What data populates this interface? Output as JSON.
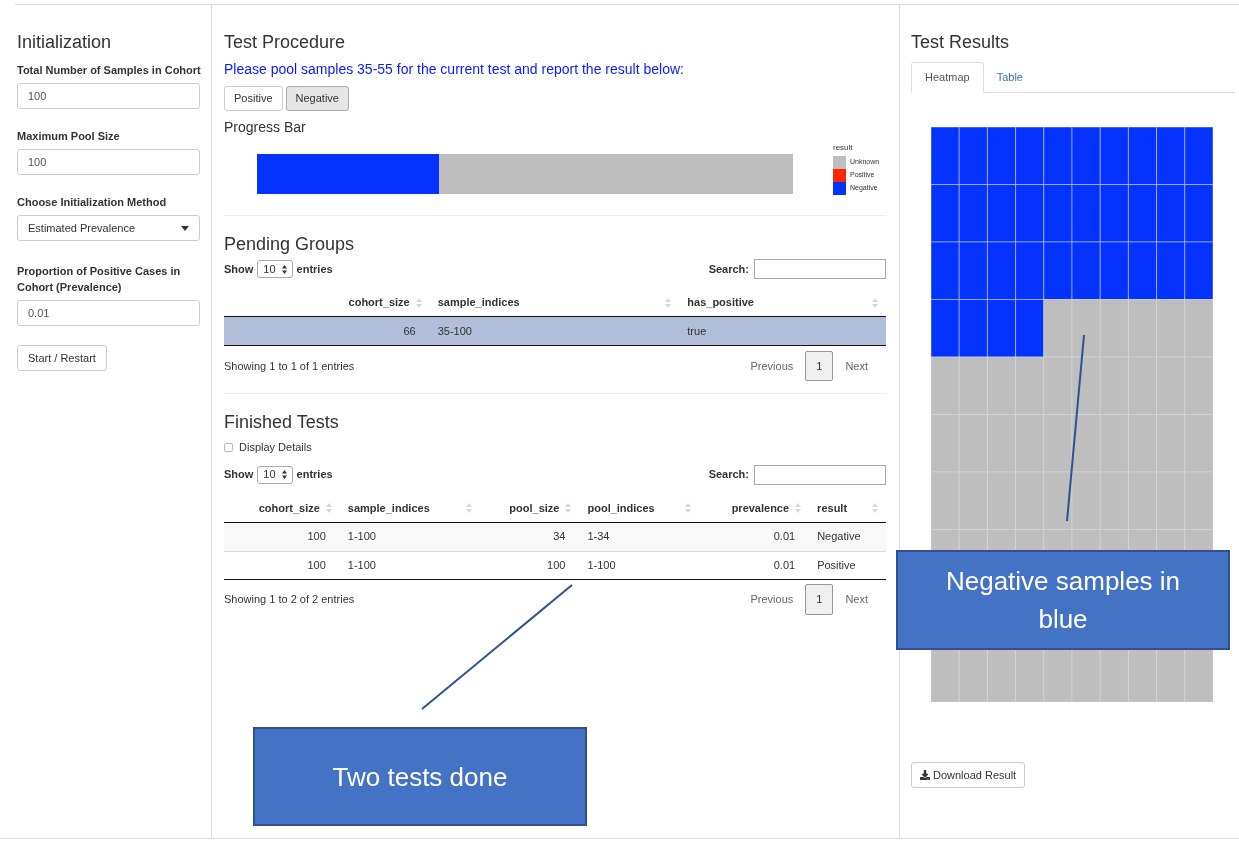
{
  "initialization": {
    "title": "Initialization",
    "fields": [
      {
        "kind": "input",
        "label": "Total Number of Samples in Cohort",
        "value": "100"
      },
      {
        "kind": "input",
        "label": "Maximum Pool Size",
        "value": "100"
      },
      {
        "kind": "select",
        "label": "Choose Initialization Method",
        "value": "Estimated Prevalence"
      },
      {
        "kind": "input",
        "label": "Proportion of Positive Cases in Cohort (Prevalence)",
        "value": "0.01"
      }
    ],
    "button": "Start / Restart"
  },
  "test_procedure": {
    "title": "Test Procedure",
    "instruction": "Please pool samples 35-55 for the current test and report the result below:",
    "buttons": [
      {
        "label": "Positive",
        "selected": false
      },
      {
        "label": "Negative",
        "selected": true
      }
    ],
    "progress_title": "Progress Bar",
    "progress": {
      "level": 0.34
    },
    "legend": {
      "title": "result",
      "items": [
        {
          "label": "Unknown",
          "color": "#bebebe"
        },
        {
          "label": "Positive",
          "color": "#ff2600"
        },
        {
          "label": "Negative",
          "color": "#0433ff"
        }
      ]
    }
  },
  "pending_groups": {
    "title": "Pending Groups",
    "table": {
      "show_label": "Show",
      "length": "10",
      "entries_label": "entries",
      "search_label": "Search:",
      "columns": [
        {
          "label": "cohort_size",
          "kind": "number"
        },
        {
          "label": "sample_indices",
          "kind": "text"
        },
        {
          "label": "has_positive",
          "kind": "text"
        }
      ],
      "rows": [
        {
          "cells": [
            "66",
            "35-100",
            "true"
          ],
          "selected": true
        }
      ],
      "info": "Showing 1 to 1 of 1 entries",
      "pagination": {
        "previous": "Previous",
        "page": "1",
        "next": "Next"
      }
    }
  },
  "finished_tests": {
    "title": "Finished Tests",
    "display_details": {
      "label": "Display Details",
      "checked": false
    },
    "table": {
      "show_label": "Show",
      "length": "10",
      "entries_label": "entries",
      "search_label": "Search:",
      "columns": [
        {
          "label": "cohort_size",
          "kind": "number"
        },
        {
          "label": "sample_indices",
          "kind": "text"
        },
        {
          "label": "pool_size",
          "kind": "number"
        },
        {
          "label": "pool_indices",
          "kind": "text"
        },
        {
          "label": "prevalence",
          "kind": "number"
        },
        {
          "label": "result",
          "kind": "text"
        }
      ],
      "rows": [
        {
          "cells": [
            "100",
            "1-100",
            "34",
            "1-34",
            "0.01",
            "Negative"
          ],
          "selected": false
        },
        {
          "cells": [
            "100",
            "1-100",
            "100",
            "1-100",
            "0.01",
            "Positive"
          ],
          "selected": false
        }
      ],
      "info": "Showing 1 to 2 of 2 entries",
      "pagination": {
        "previous": "Previous",
        "page": "1",
        "next": "Next"
      }
    }
  },
  "test_results": {
    "title": "Test Results",
    "tabs": [
      {
        "label": "Heatmap",
        "selected": true
      },
      {
        "label": "Table",
        "selected": false
      }
    ],
    "download_button": "Download Result"
  },
  "callouts": [
    {
      "text": "Two tests done"
    },
    {
      "text": "Negative samples in blue"
    }
  ]
}
